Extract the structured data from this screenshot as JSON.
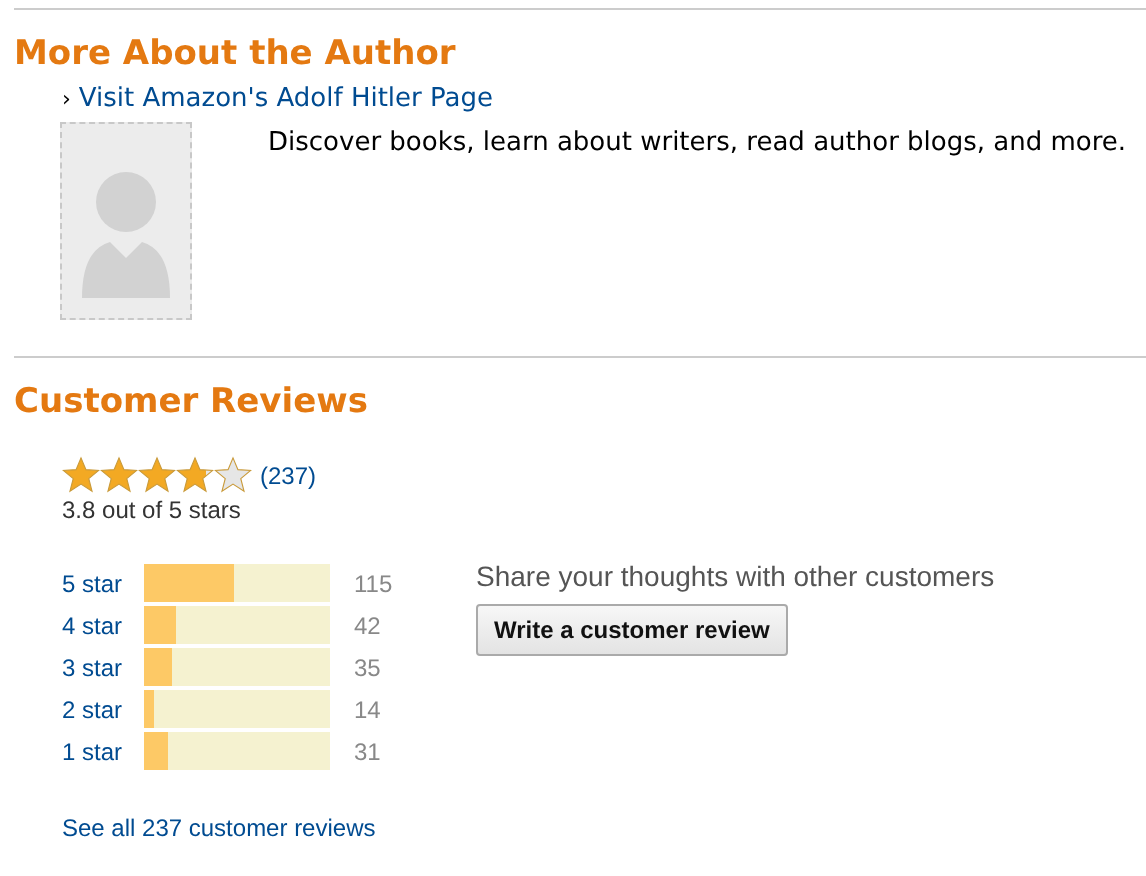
{
  "author_section": {
    "heading": "More About the Author",
    "link_arrow": "›",
    "link": "Visit Amazon's Adolf Hitler Page",
    "description": "Discover books, learn about writers, read author blogs, and more."
  },
  "reviews": {
    "heading": "Customer Reviews",
    "stars": 3.8,
    "count": "(237)",
    "summary": "3.8 out of 5 stars",
    "histogram": [
      {
        "label": "5 star",
        "level": 0.485,
        "count": "115"
      },
      {
        "label": "4 star",
        "level": 0.177,
        "count": "42"
      },
      {
        "label": "3 star",
        "level": 0.148,
        "count": "35"
      },
      {
        "label": "2 star",
        "level": 0.059,
        "count": "14"
      },
      {
        "label": "1 star",
        "level": 0.131,
        "count": "31"
      }
    ],
    "prompt": "Share your thoughts with other customers",
    "button": "Write a customer review",
    "see_all": "See all 237 customer reviews"
  }
}
